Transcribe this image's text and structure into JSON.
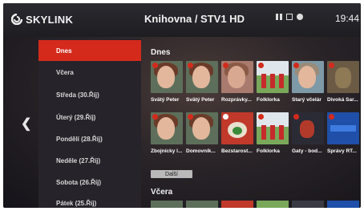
{
  "app": {
    "brand": "SKYLINK",
    "title": "Knihovna / STV1 HD",
    "clock": "19:44"
  },
  "status_icons": [
    "pause-icon",
    "stop-icon",
    "record-icon"
  ],
  "colors": {
    "accent": "#d42a1c",
    "sidebar": "#26232a"
  },
  "sidebar": {
    "items": [
      {
        "label": "Dnes",
        "active": true
      },
      {
        "label": "Včera",
        "active": false
      },
      {
        "label": "Středa (30.Říj)",
        "active": false
      },
      {
        "label": "Úterý (29.Říj)",
        "active": false
      },
      {
        "label": "Pondělí (28.Říj)",
        "active": false
      },
      {
        "label": "Neděle (27.Říj)",
        "active": false
      },
      {
        "label": "Sobota (26.Říj)",
        "active": false
      },
      {
        "label": "Pátek (25.Říj)",
        "active": false
      }
    ]
  },
  "sections": {
    "today": {
      "title": "Dnes",
      "row1": [
        {
          "label": "Svätý Peter"
        },
        {
          "label": "Svätý Peter"
        },
        {
          "label": "Rozprávky..."
        },
        {
          "label": "Folklorka"
        },
        {
          "label": "Starý včelár"
        },
        {
          "label": "Divoká Sar..."
        }
      ],
      "row2": [
        {
          "label": "Zbojnícky l..."
        },
        {
          "label": "Domovník..."
        },
        {
          "label": "Bezstarost..."
        },
        {
          "label": "Folklorka"
        },
        {
          "label": "Gaty - bod..."
        },
        {
          "label": "Správy RT..."
        }
      ],
      "more_label": "Další"
    },
    "yesterday": {
      "title": "Včera"
    }
  }
}
